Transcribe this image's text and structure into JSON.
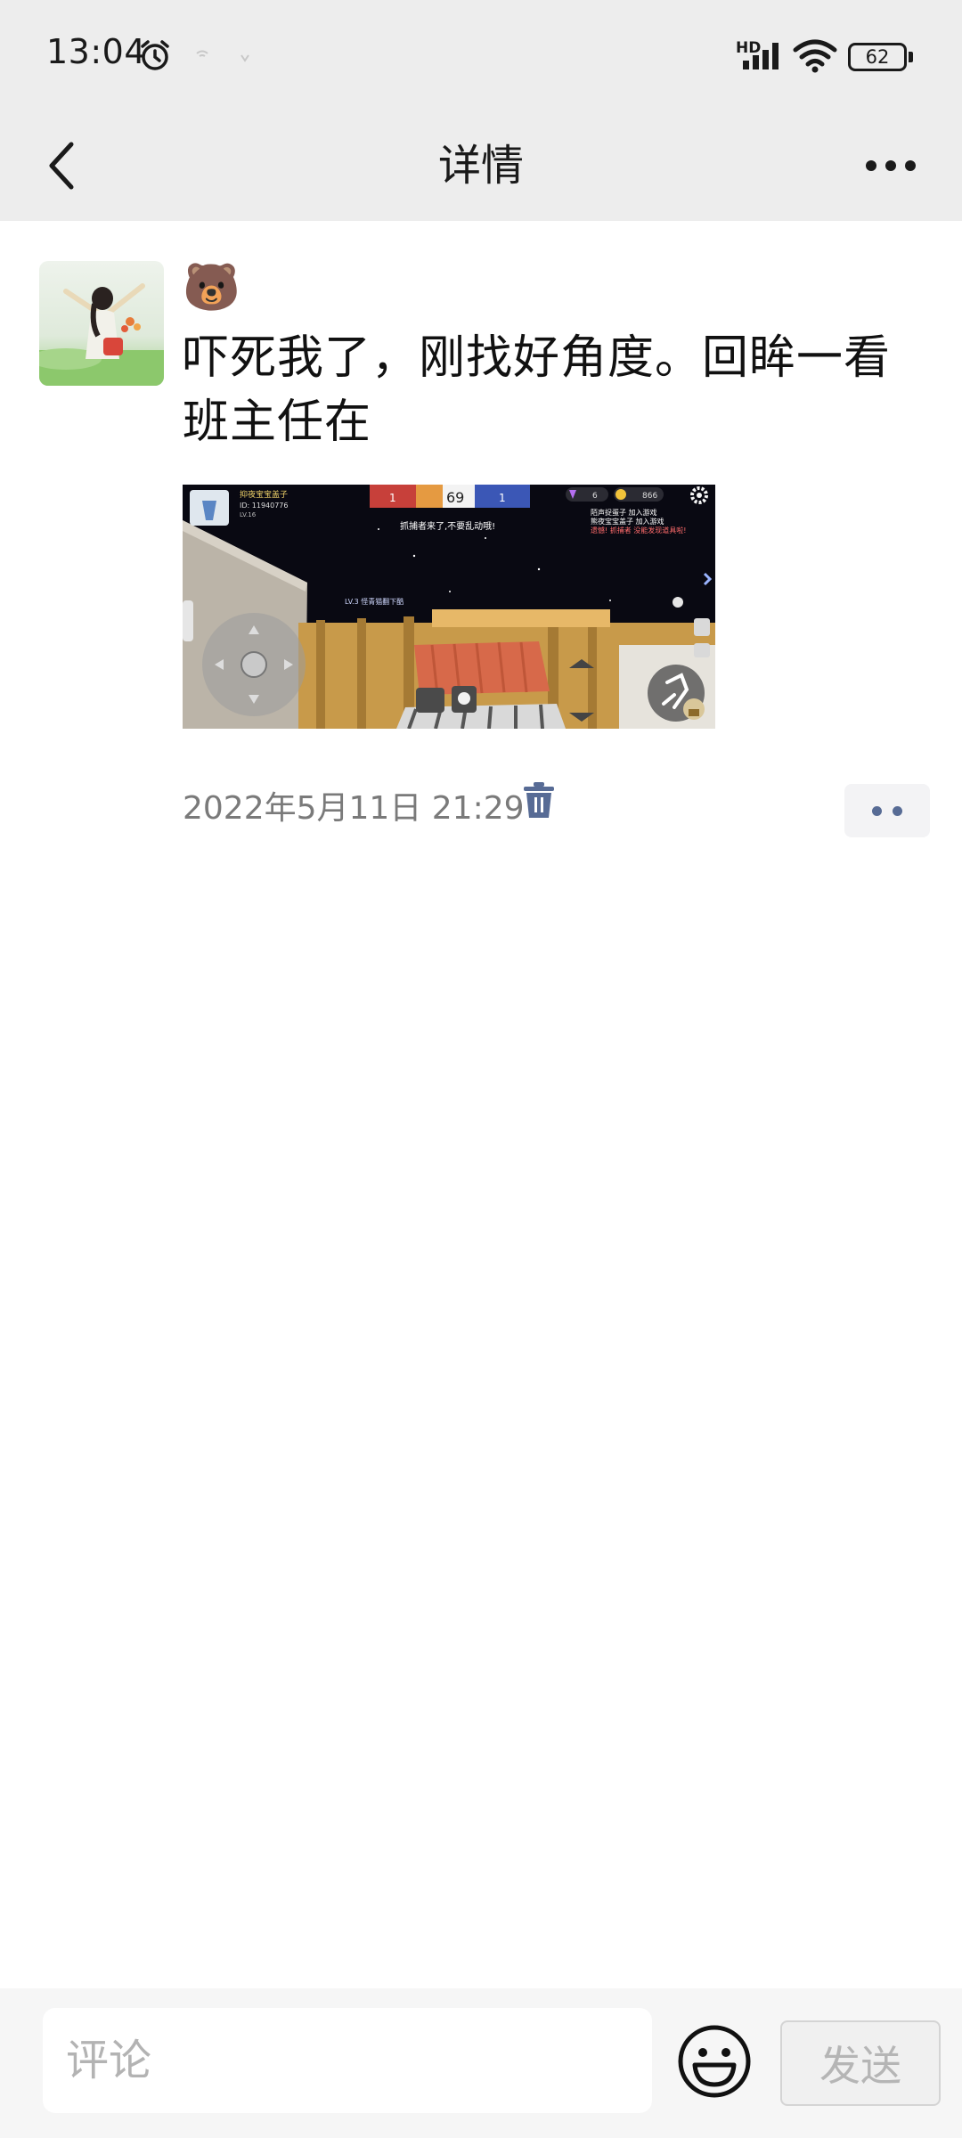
{
  "status_bar": {
    "time": "13:04",
    "battery": "62",
    "network": "HD"
  },
  "nav": {
    "title": "详情"
  },
  "post": {
    "author": "🐻",
    "text": "吓死我了，刚找好角度。回眸一看班主任在",
    "time": "2022年5月11日 21:29",
    "image": {
      "username": "抑夜宝宝盖子",
      "user_id": "ID: 11940776",
      "user_level": "LV.16",
      "top_counter": "69",
      "top_left_count": "1",
      "top_right_count": "1",
      "gem_count": "6",
      "coin_count": "866",
      "notice": "抓捕者来了,不要乱动哦!",
      "log_1": "陌声捉蛋子 加入游戏",
      "log_2": "熊夜宝宝盖子 加入游戏",
      "log_3": "遗憾! 抓捕者 没能发现道具啦!",
      "player_tag": "LV.3 怪青猫翻下酷"
    }
  },
  "comment_bar": {
    "placeholder": "评论",
    "send_label": "发送"
  },
  "colors": {
    "header_bg": "#ededed",
    "link_blue": "#576b95",
    "send_disabled": "#b5b5b5"
  }
}
